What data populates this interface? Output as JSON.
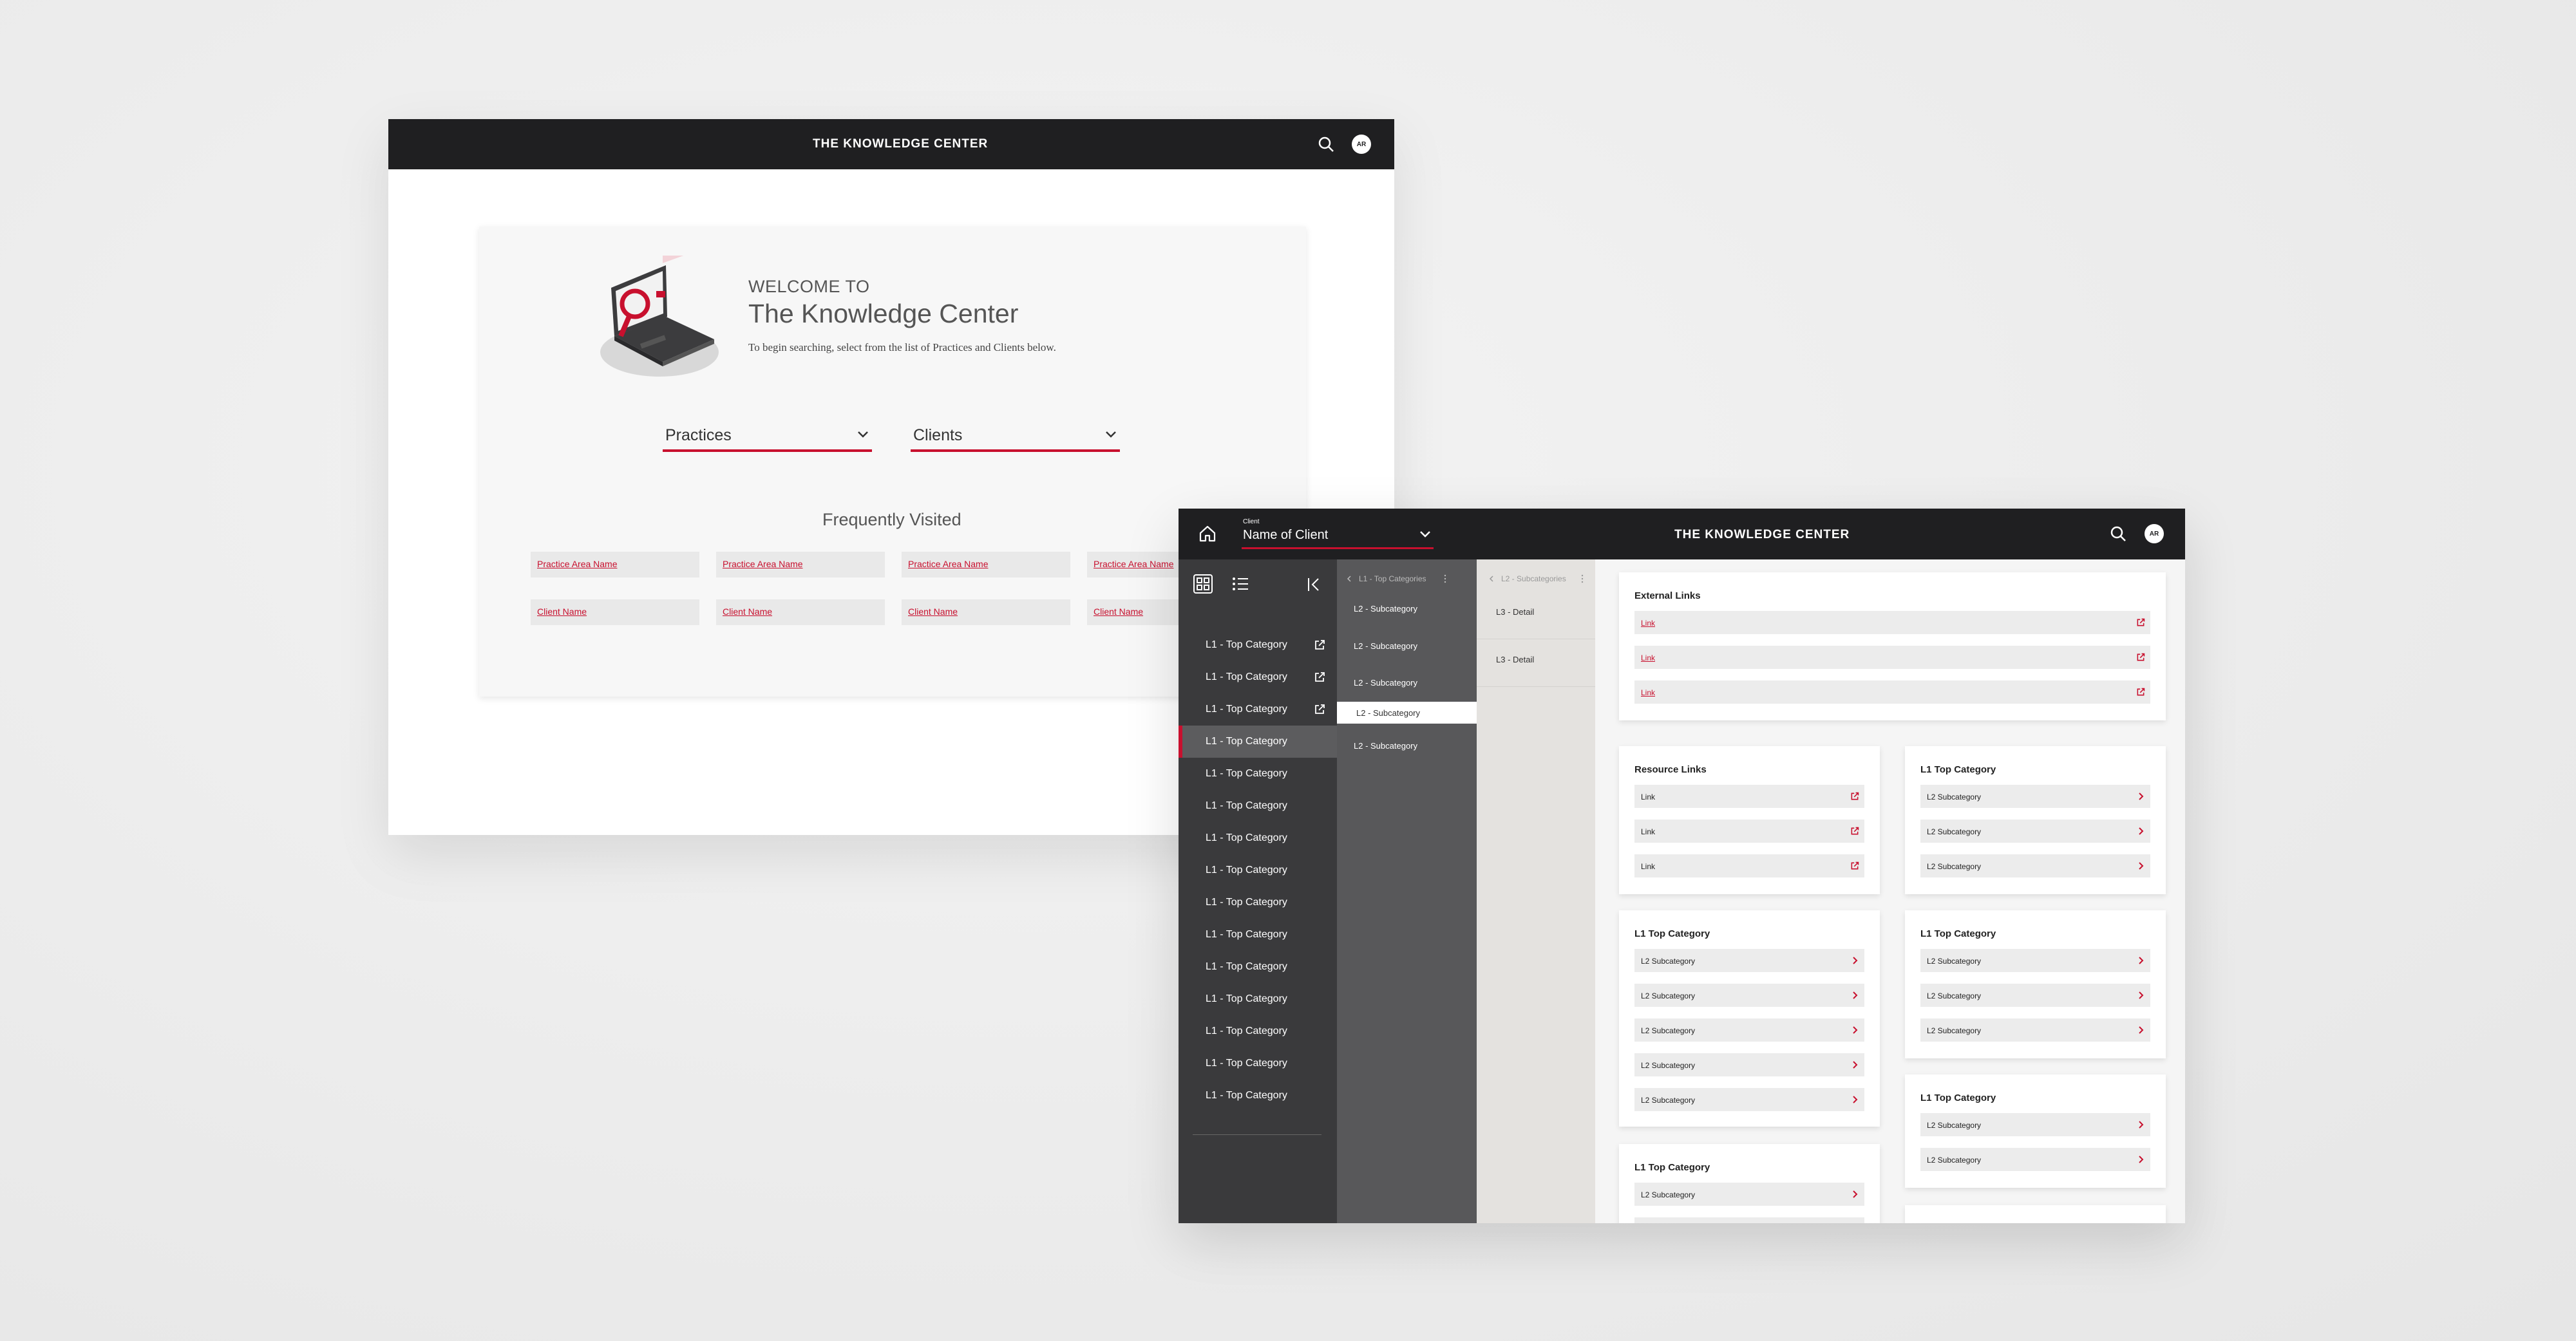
{
  "colors": {
    "accent": "#c8102e",
    "topbar": "#1f1f21",
    "sidebar_dark": "#3a3a3c",
    "sidebar_mid": "#58585a",
    "detail_col": "#e4e2df"
  },
  "landing": {
    "app_title": "THE KNOWLEDGE CENTER",
    "avatar_initials": "AR",
    "welcome_small": "WELCOME TO",
    "welcome_title": "The Knowledge Center",
    "welcome_subtitle": "To begin searching, select from the list of Practices and Clients below.",
    "practices_label": "Practices",
    "clients_label": "Clients",
    "frequently_visited_title": "Frequently Visited",
    "practice_chips": [
      "Practice Area Name",
      "Practice Area Name",
      "Practice Area Name",
      "Practice Area Name"
    ],
    "client_chips": [
      "Client Name",
      "Client Name",
      "Client Name",
      "Client Name"
    ]
  },
  "client_view": {
    "app_title": "THE KNOWLEDGE CENTER",
    "avatar_initials": "AR",
    "client_label": "Client",
    "client_name": "Name of Client",
    "nav_items": [
      "L1 - Top Category",
      "L1 - Top Category",
      "L1 - Top Category",
      "L1 - Top Category",
      "L1 - Top Category",
      "L1 - Top Category",
      "L1 - Top Category",
      "L1 - Top Category",
      "L1 - Top Category",
      "L1 - Top Category",
      "L1 - Top Category",
      "L1 - Top Category",
      "L1 - Top Category",
      "L1 - Top Category",
      "L1 - Top Category"
    ],
    "l1_crumb": "L1 - Top Categories",
    "l2_crumb": "L2 - Subcategories",
    "subcategories": [
      "L2 - Subcategory",
      "L2 - Subcategory",
      "L2 - Subcategory",
      "L2 - Subcategory",
      "L2 - Subcategory"
    ],
    "details": [
      "L3 - Detail",
      "L3 - Detail"
    ],
    "external_links": {
      "title": "External Links",
      "links": [
        "Link",
        "Link",
        "Link"
      ]
    },
    "resource_links": {
      "title": "Resource Links",
      "links": [
        "Link",
        "Link",
        "Link"
      ]
    },
    "category_panels": [
      {
        "title": "L1 Top Category",
        "items": [
          "L2 Subcategory",
          "L2 Subcategory",
          "L2 Subcategory"
        ]
      },
      {
        "title": "L1 Top Category",
        "items": [
          "L2 Subcategory",
          "L2 Subcategory",
          "L2 Subcategory",
          "L2 Subcategory",
          "L2 Subcategory"
        ]
      },
      {
        "title": "L1 Top Category",
        "items": [
          "L2 Subcategory",
          "L2 Subcategory",
          "L2 Subcategory"
        ]
      },
      {
        "title": "L1 Top Category",
        "items": [
          "L2 Subcategory",
          "L2 Subcategory"
        ]
      },
      {
        "title": "L1 Top Category",
        "items": [
          "L2 Subcategory"
        ]
      }
    ]
  }
}
